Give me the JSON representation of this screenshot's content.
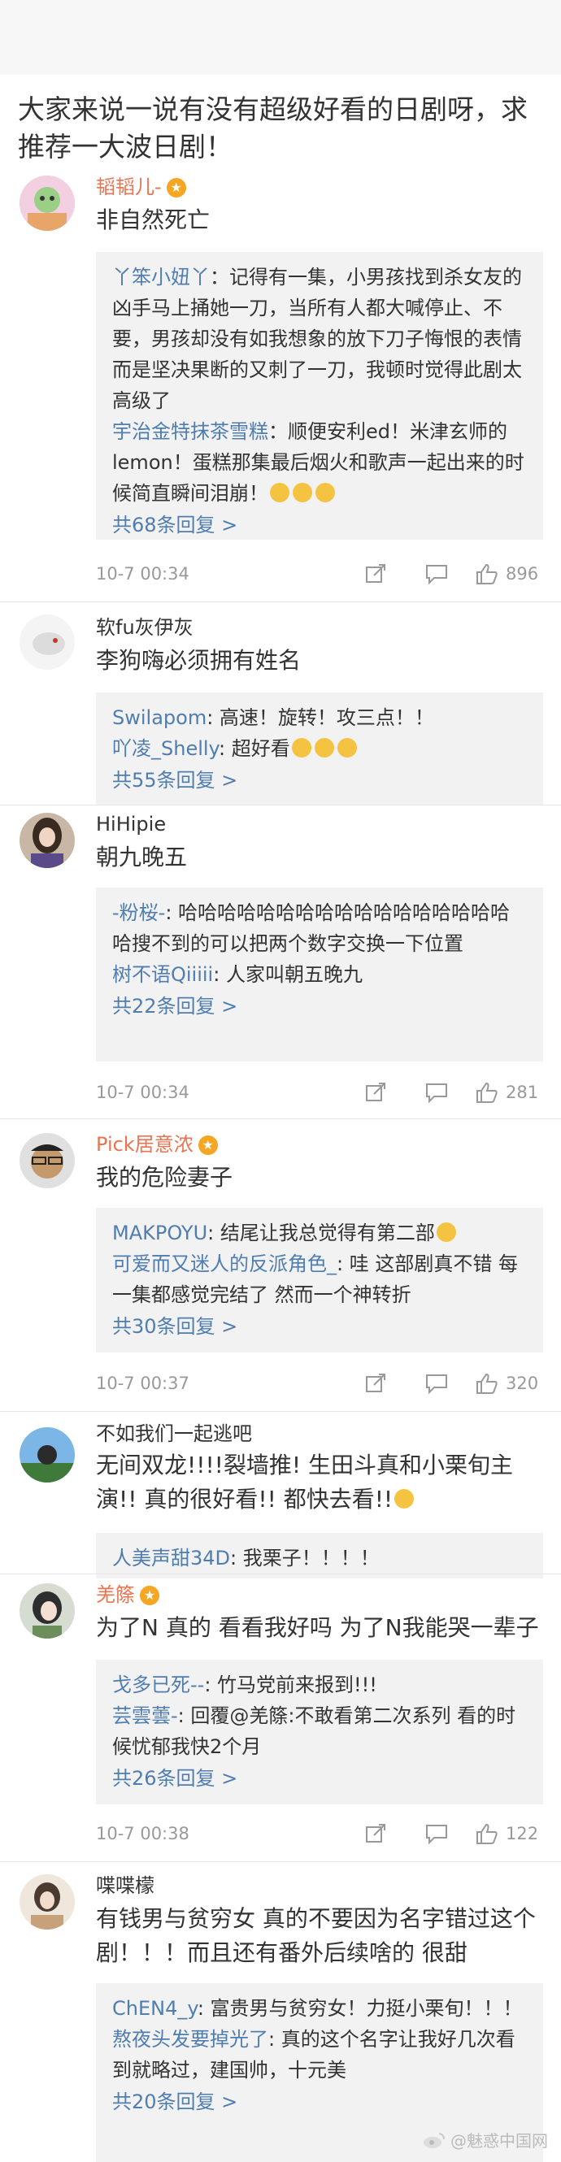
{
  "question": "大家来说一说有没有超级好看的日剧呀，求推荐一大波日剧！",
  "comments": [
    {
      "user": "韬韬儿-",
      "text": "非自然死亡",
      "replies": [
        {
          "name": "丫笨小妞丫",
          "text": "：记得有一集，小男孩找到杀女友的凶手马上捅她一刀，当所有人都大喊停止、不要，男孩却没有如我想象的放下刀子悔恨的表情而是坚决果断的又刺了一刀，我顿时觉得此剧太高级了"
        },
        {
          "name": "宇治金特抹茶雪糕",
          "text": "：顺便安利ed！米津玄师的lemon！蛋糕那集最后烟火和歌声一起出来的时候简直瞬间泪崩！"
        }
      ],
      "more": "共68条回复 >",
      "time": "10-7 00:34",
      "likes": "896"
    },
    {
      "user": "软fu灰伊灰",
      "text": "李狗嗨必须拥有姓名",
      "replies": [
        {
          "name": "Swilapom",
          "text": ": 高速！旋转！攻三点！！"
        },
        {
          "name": "吖凌_Shelly",
          "text": ": 超好看"
        }
      ],
      "more": "共55条回复 >"
    },
    {
      "user": "HiHipie",
      "text": "朝九晚五",
      "replies": [
        {
          "name": "-粉桜-",
          "text": ": 哈哈哈哈哈哈哈哈哈哈哈哈哈哈哈哈哈哈搜不到的可以把两个数字交换一下位置"
        },
        {
          "name": "树不语Qiiiii",
          "text": ": 人家叫朝五晚九"
        }
      ],
      "more": "共22条回复 >",
      "time": "10-7 00:34",
      "likes": "281"
    },
    {
      "user": "Pick居意浓",
      "text": "我的危险妻子",
      "replies": [
        {
          "name": "MAKPOYU",
          "text": ": 结尾让我总觉得有第二部"
        },
        {
          "name": "可爱而又迷人的反派角色_",
          "text": ": 哇 这部剧真不错 每一集都感觉完结了 然而一个神转折"
        }
      ],
      "more": "共30条回复 >",
      "time": "10-7 00:37",
      "likes": "320"
    },
    {
      "user": "不如我们一起逃吧",
      "text": "无间双龙!!!!裂墙推! 生田斗真和小栗旬主演!! 真的很好看!! 都快去看!!",
      "replies": [
        {
          "name": "人美声甜34D",
          "text": ": 我栗子！！！！"
        }
      ]
    },
    {
      "user": "羌篨",
      "text": "为了N 真的 看看我好吗 为了N我能哭一辈子",
      "replies": [
        {
          "name": "戈多已死--",
          "text": ": 竹马党前来报到!!!"
        },
        {
          "name": "芸雲蕓-",
          "text": ": 回覆@羌篨:不敢看第二次系列 看的时候忧郁我快2个月"
        }
      ],
      "more": "共26条回复 >",
      "time": "10-7 00:38",
      "likes": "122"
    },
    {
      "user": "喋喋檬",
      "text": "有钱男与贫穷女 真的不要因为名字错过这个剧！！！而且还有番外后续啥的 很甜",
      "replies": [
        {
          "name": "ChEN4_y",
          "text": ": 富贵男与贫穷女！力挺小栗旬！！！"
        },
        {
          "name": "熬夜头发要掉光了",
          "text": ": 真的这个名字让我好几次看到就略过，建国帅，十元美"
        }
      ],
      "more": "共20条回复 >"
    }
  ],
  "watermark": "@魅惑中国网",
  "colors": {
    "link": "#507daf",
    "vip": "#eb7350",
    "reply_bg": "#f2f2f2"
  }
}
